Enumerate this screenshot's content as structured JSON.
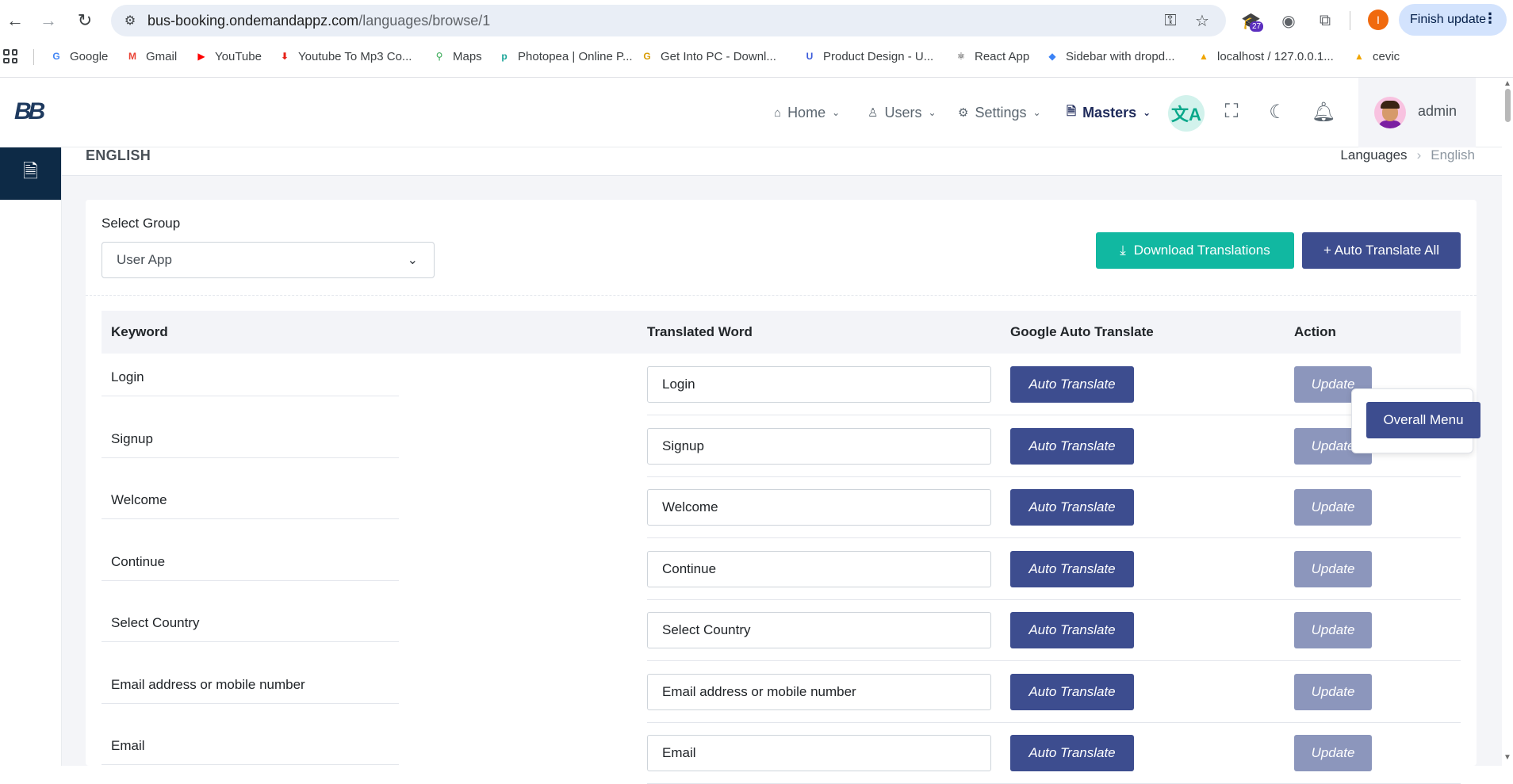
{
  "browser": {
    "url_host": "bus-booking.ondemandappz.com",
    "url_path": "/languages/browse/1",
    "extension_badge": "27",
    "profile_initial": "I",
    "finish_update_label": "Finish update",
    "bookmarks": [
      {
        "label": "Google",
        "icon": "G",
        "color": "#4285f4"
      },
      {
        "label": "Gmail",
        "icon": "M",
        "color": "#ea4335"
      },
      {
        "label": "YouTube",
        "icon": "▶",
        "color": "#ff0000"
      },
      {
        "label": "Youtube To Mp3 Co...",
        "icon": "⬇",
        "color": "#e62117"
      },
      {
        "label": "Maps",
        "icon": "⚲",
        "color": "#34a853"
      },
      {
        "label": "Photopea | Online P...",
        "icon": "p",
        "color": "#18a497"
      },
      {
        "label": "Get Into PC - Downl...",
        "icon": "G",
        "color": "#d89b00"
      },
      {
        "label": "Product Design - U...",
        "icon": "U",
        "color": "#3b5bdb"
      },
      {
        "label": "React App",
        "icon": "⚛",
        "color": "#222222"
      },
      {
        "label": "Sidebar with dropd...",
        "icon": "◆",
        "color": "#3b82f6"
      },
      {
        "label": "localhost / 127.0.0.1...",
        "icon": "▲",
        "color": "#f0a500"
      },
      {
        "label": "cevic",
        "icon": "▲",
        "color": "#f0a500"
      }
    ]
  },
  "topbar": {
    "logo_text": "BB",
    "menus": [
      {
        "label": "Home",
        "icon": "⌂"
      },
      {
        "label": "Users",
        "icon": "♙"
      },
      {
        "label": "Settings",
        "icon": "⚙"
      },
      {
        "label": "Masters",
        "icon": "🗎"
      }
    ],
    "translate_icon": "文A",
    "username": "admin"
  },
  "page": {
    "title": "ENGLISH",
    "breadcrumb": [
      "Languages",
      "English"
    ]
  },
  "filters": {
    "group_label": "Select Group",
    "group_value": "User App",
    "download_label": "Download Translations",
    "auto_all_label": "+ Auto Translate All"
  },
  "table": {
    "headers": [
      "Keyword",
      "Translated Word",
      "Google Auto Translate",
      "Action"
    ],
    "auto_translate_label": "Auto Translate",
    "update_label": "Update",
    "rows": [
      {
        "keyword": "Login",
        "translated": "Login"
      },
      {
        "keyword": "Signup",
        "translated": "Signup"
      },
      {
        "keyword": "Welcome",
        "translated": "Welcome"
      },
      {
        "keyword": "Continue",
        "translated": "Continue"
      },
      {
        "keyword": "Select Country",
        "translated": "Select Country"
      },
      {
        "keyword": "Email address or mobile number",
        "translated": "Email address or mobile number"
      },
      {
        "keyword": "Email",
        "translated": "Email"
      }
    ]
  },
  "overall_menu_label": "Overall Menu"
}
